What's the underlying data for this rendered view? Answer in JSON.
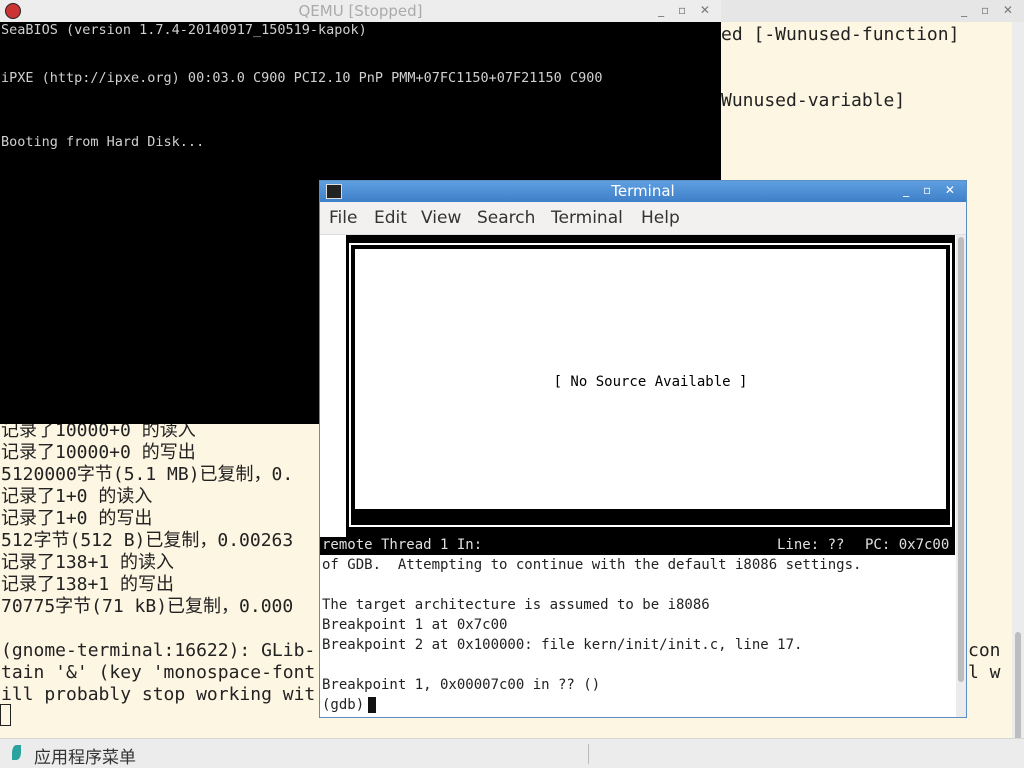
{
  "background_terminal": {
    "lines": [
      "ed [-Wunused-function]",
      "Wunused-variable]",
      "记录了10000+0 的读入",
      "记录了10000+0 的写出",
      "5120000字节(5.1 MB)已复制，0.",
      "记录了1+0 的读入",
      "记录了1+0 的写出",
      "512字节(512 B)已复制，0.00263",
      "记录了138+1 的读入",
      "记录了138+1 的写出",
      "70775字节(71 kB)已复制，0.000",
      "(gnome-terminal:16622): GLib-",
      "tain '&' (key 'monospace-font",
      "ill probably stop working wit",
      "con",
      "l w"
    ]
  },
  "qemu": {
    "title": "QEMU [Stopped]",
    "screen_lines": [
      "SeaBIOS (version 1.7.4-20140917_150519-kapok)",
      "iPXE (http://ipxe.org) 00:03.0 C900 PCI2.10 PnP PMM+07FC1150+07F21150 C900",
      "Booting from Hard Disk..."
    ]
  },
  "gdb_window": {
    "title": "Terminal",
    "menu": [
      "File",
      "Edit",
      "View",
      "Search",
      "Terminal",
      "Help"
    ],
    "source_pane_text": "[ No Source Available ]",
    "status": {
      "thread": "remote Thread 1 In:",
      "line": "Line: ??",
      "pc": "PC: 0x7c00"
    },
    "output_lines": [
      "of GDB.  Attempting to continue with the default i8086 settings.",
      "",
      "The target architecture is assumed to be i8086",
      "Breakpoint 1 at 0x7c00",
      "Breakpoint 2 at 0x100000: file kern/init/init.c, line 17.",
      "",
      "Breakpoint 1, 0x00007c00 in ?? ()"
    ],
    "prompt": "(gdb)"
  },
  "taskbar": {
    "app_menu_label": "应用程序菜单"
  }
}
